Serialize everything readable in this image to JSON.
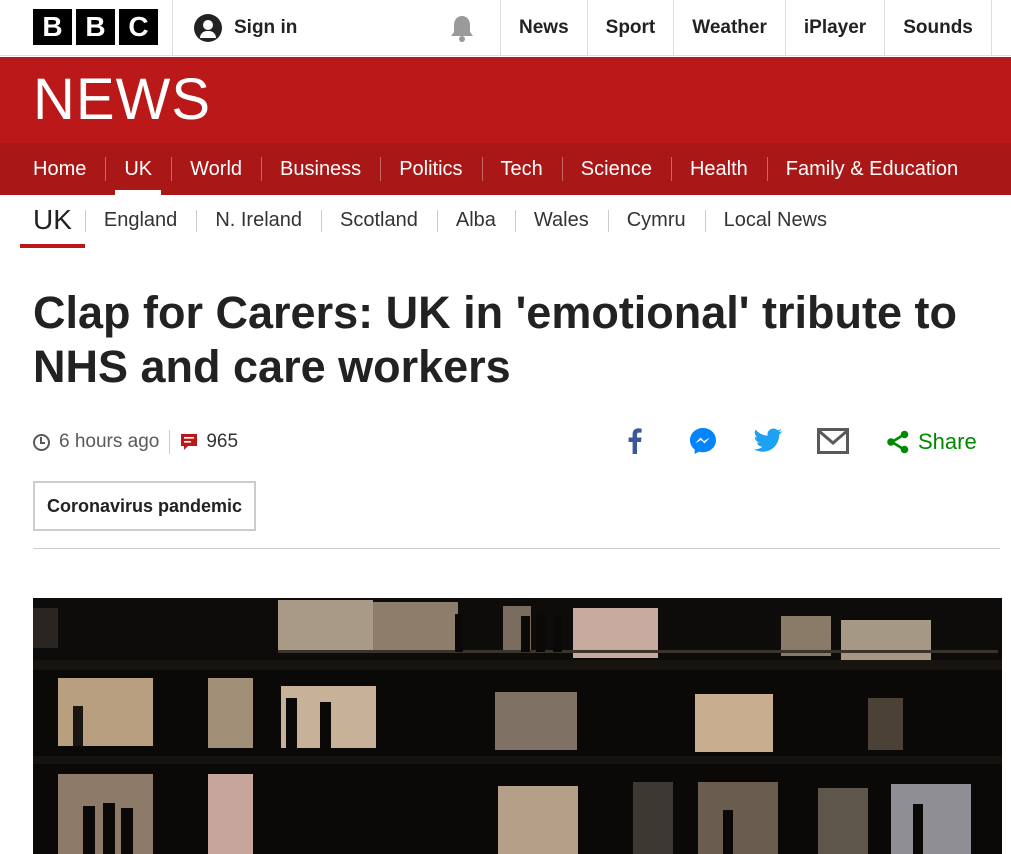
{
  "topbar": {
    "logo_letters": [
      "B",
      "B",
      "C"
    ],
    "signin_label": "Sign in",
    "links": [
      "News",
      "Sport",
      "Weather",
      "iPlayer",
      "Sounds"
    ]
  },
  "masthead": {
    "wordmark": "NEWS"
  },
  "section_nav": {
    "items": [
      "Home",
      "UK",
      "World",
      "Business",
      "Politics",
      "Tech",
      "Science",
      "Health",
      "Family & Education"
    ],
    "active": "UK"
  },
  "sub_nav": {
    "current": "UK",
    "items": [
      "England",
      "N. Ireland",
      "Scotland",
      "Alba",
      "Wales",
      "Cymru",
      "Local News"
    ]
  },
  "article": {
    "headline": "Clap for Carers: UK in 'emotional' tribute to NHS and care workers",
    "timestamp": "6 hours ago",
    "comment_count": "965",
    "share_label": "Share",
    "tag": "Coronavirus pandemic"
  },
  "colors": {
    "brand_red": "#bb1919",
    "nav_red": "#a91717",
    "share_green": "#008a00",
    "facebook_blue": "#3b5998",
    "messenger_blue": "#0084ff",
    "twitter_blue": "#1da1f2"
  },
  "icons": {
    "signin": "user-avatar-icon",
    "notifications": "bell-icon",
    "timestamp": "clock-icon",
    "comments": "comment-icon",
    "share": [
      "facebook-icon",
      "messenger-icon",
      "twitter-icon",
      "email-icon",
      "share-icon"
    ]
  }
}
